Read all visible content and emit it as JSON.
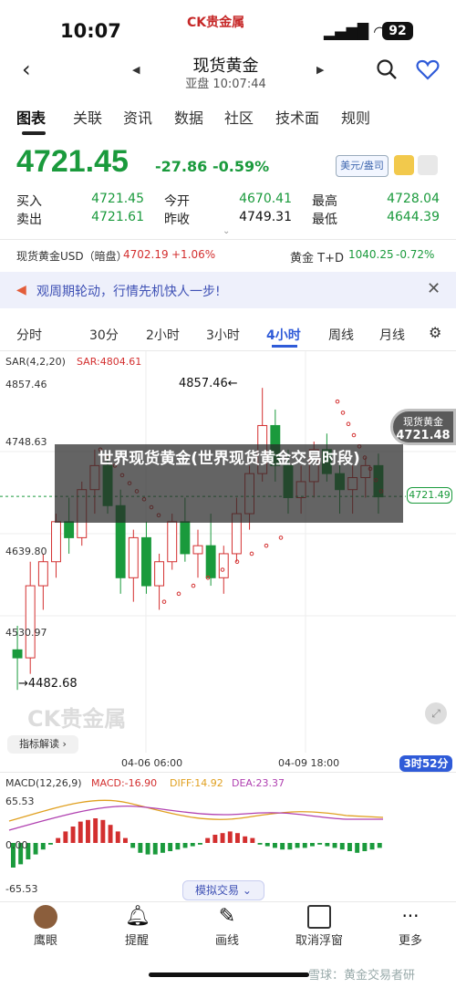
{
  "status": {
    "time": "10:07",
    "brand": "CK贵金属",
    "battery": "92"
  },
  "nav": {
    "title": "现货黄金",
    "subtitle": "亚盘 10:07:44"
  },
  "tabs": [
    "图表",
    "关联",
    "资讯",
    "数据",
    "社区",
    "技术面",
    "规则"
  ],
  "quote": {
    "price": "4721.45",
    "change": "-27.86",
    "change_pct": "-0.59%",
    "currency": "美元/盎司",
    "rows": [
      {
        "l1": "买入",
        "v1": "4721.45",
        "l2": "今开",
        "v2": "4670.41",
        "l3": "最高",
        "v3": "4728.04"
      },
      {
        "l1": "卖出",
        "v1": "4721.61",
        "l2": "昨收",
        "v2": "4749.31",
        "l3": "最低",
        "v3": "4644.39"
      }
    ]
  },
  "ticker": {
    "left_name": "现货黄金USD（暗盘）",
    "left_price": "4702.19",
    "left_pct": "+1.06%",
    "right_name": "黄金 T+D",
    "right_price": "1040.25",
    "right_pct": "-0.72%"
  },
  "banner": {
    "text": "观周期轮动，行情先机快人一步!"
  },
  "periods": {
    "items": [
      "分时",
      "30分",
      "2小时",
      "3小时",
      "4小时",
      "周线",
      "月线"
    ],
    "active": "4小时"
  },
  "chart": {
    "indicator": "SAR(4,2,20)",
    "sar_value": "SAR:4804.61",
    "y_labels": [
      "4857.46",
      "4748.63",
      "4639.80",
      "4530.97"
    ],
    "high_mark": "4857.46",
    "low_mark": "4482.68",
    "current_tag_name": "现货黄金",
    "current_tag_price": "4721.48",
    "current_line_price": "4721.49",
    "x_labels": [
      "04-06 06:00",
      "04-09 18:00"
    ],
    "countdown": "3时52分",
    "indicator_btn": "指标解读",
    "watermark": "CK贵金属"
  },
  "chart_data": {
    "type": "candlestick",
    "ylim": [
      4470,
      4880
    ],
    "candles": [
      {
        "o": 4530,
        "h": 4560,
        "l": 4480,
        "c": 4520
      },
      {
        "o": 4520,
        "h": 4640,
        "l": 4500,
        "c": 4610
      },
      {
        "o": 4610,
        "h": 4650,
        "l": 4580,
        "c": 4640
      },
      {
        "o": 4640,
        "h": 4700,
        "l": 4620,
        "c": 4690
      },
      {
        "o": 4690,
        "h": 4720,
        "l": 4650,
        "c": 4670
      },
      {
        "o": 4670,
        "h": 4740,
        "l": 4660,
        "c": 4730
      },
      {
        "o": 4730,
        "h": 4780,
        "l": 4700,
        "c": 4760
      },
      {
        "o": 4760,
        "h": 4775,
        "l": 4700,
        "c": 4710
      },
      {
        "o": 4710,
        "h": 4730,
        "l": 4600,
        "c": 4620
      },
      {
        "o": 4620,
        "h": 4680,
        "l": 4590,
        "c": 4670
      },
      {
        "o": 4670,
        "h": 4690,
        "l": 4600,
        "c": 4610
      },
      {
        "o": 4610,
        "h": 4650,
        "l": 4580,
        "c": 4640
      },
      {
        "o": 4640,
        "h": 4700,
        "l": 4630,
        "c": 4690
      },
      {
        "o": 4690,
        "h": 4720,
        "l": 4640,
        "c": 4650
      },
      {
        "o": 4650,
        "h": 4680,
        "l": 4620,
        "c": 4660
      },
      {
        "o": 4660,
        "h": 4700,
        "l": 4610,
        "c": 4620
      },
      {
        "o": 4620,
        "h": 4660,
        "l": 4600,
        "c": 4650
      },
      {
        "o": 4650,
        "h": 4720,
        "l": 4640,
        "c": 4700
      },
      {
        "o": 4700,
        "h": 4760,
        "l": 4680,
        "c": 4750
      },
      {
        "o": 4750,
        "h": 4857,
        "l": 4740,
        "c": 4810
      },
      {
        "o": 4810,
        "h": 4830,
        "l": 4740,
        "c": 4760
      },
      {
        "o": 4760,
        "h": 4780,
        "l": 4700,
        "c": 4720
      },
      {
        "o": 4720,
        "h": 4760,
        "l": 4700,
        "c": 4740
      },
      {
        "o": 4740,
        "h": 4790,
        "l": 4720,
        "c": 4780
      },
      {
        "o": 4780,
        "h": 4800,
        "l": 4740,
        "c": 4750
      },
      {
        "o": 4750,
        "h": 4770,
        "l": 4700,
        "c": 4730
      },
      {
        "o": 4730,
        "h": 4760,
        "l": 4700,
        "c": 4745
      },
      {
        "o": 4745,
        "h": 4770,
        "l": 4720,
        "c": 4760
      },
      {
        "o": 4760,
        "h": 4775,
        "l": 4700,
        "c": 4721
      }
    ],
    "sar_above": [
      4780,
      4770,
      4760,
      4748,
      4738,
      4728,
      4718,
      4708,
      4698
    ],
    "sar_below": [
      4590,
      4600,
      4610,
      4620,
      4630,
      4640,
      4650,
      4660,
      4670
    ]
  },
  "macd": {
    "title": "MACD(12,26,9)",
    "macd": "MACD:-16.90",
    "diff": "DIFF:14.92",
    "dea": "DEA:23.37",
    "y_labels": [
      "65.53",
      "0.00",
      "-65.53"
    ],
    "sim_btn": "模拟交易"
  },
  "bottom_nav": [
    "鹰眼",
    "提醒",
    "画线",
    "取消浮窗",
    "更多"
  ],
  "watermark_title": "世界现货黄金(世界现货黄金交易时段)",
  "footer_wm": "雪球：黄金交易者研",
  "colors": {
    "green": "#1a9a3c",
    "red": "#d32f2f",
    "blue": "#2f5bd8"
  }
}
